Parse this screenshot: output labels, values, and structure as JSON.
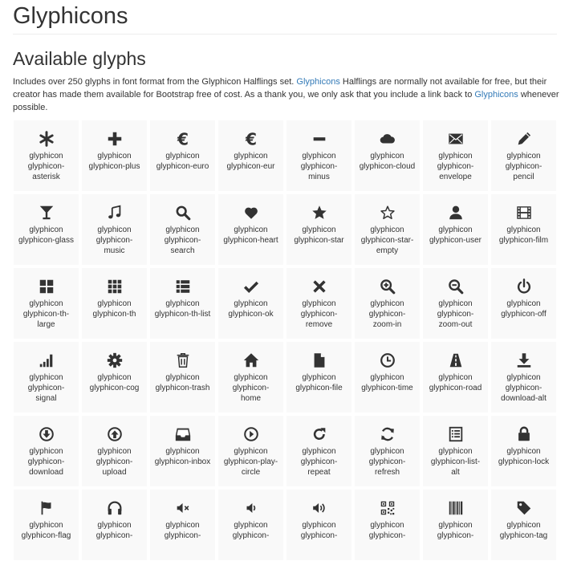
{
  "title": "Glyphicons",
  "subtitle": "Available glyphs",
  "intro": {
    "text1": "Includes over 250 glyphs in font format from the Glyphicon Halflings set.",
    "link1": "Glyphicons",
    "text2": "Halflings are normally not available for free, but their creator has made them available for Bootstrap free of cost. As a thank you, we only ask that you include a link back to",
    "link2": "Glyphicons",
    "text3": "whenever possible."
  },
  "colors": {
    "link": "#337ab7",
    "tile": "#f9f9f9",
    "text": "#333333"
  },
  "glyphs": [
    {
      "icon": "asterisk",
      "line1": "glyphicon",
      "line2": "glyphicon-",
      "line3": "asterisk"
    },
    {
      "icon": "plus",
      "line1": "glyphicon",
      "line2": "glyphicon-plus",
      "line3": ""
    },
    {
      "icon": "euro",
      "line1": "glyphicon",
      "line2": "glyphicon-euro",
      "line3": ""
    },
    {
      "icon": "eur",
      "line1": "glyphicon",
      "line2": "glyphicon-eur",
      "line3": ""
    },
    {
      "icon": "minus",
      "line1": "glyphicon",
      "line2": "glyphicon-",
      "line3": "minus"
    },
    {
      "icon": "cloud",
      "line1": "glyphicon",
      "line2": "glyphicon-cloud",
      "line3": ""
    },
    {
      "icon": "envelope",
      "line1": "glyphicon",
      "line2": "glyphicon-",
      "line3": "envelope"
    },
    {
      "icon": "pencil",
      "line1": "glyphicon",
      "line2": "glyphicon-",
      "line3": "pencil"
    },
    {
      "icon": "glass",
      "line1": "glyphicon",
      "line2": "glyphicon-glass",
      "line3": ""
    },
    {
      "icon": "music",
      "line1": "glyphicon",
      "line2": "glyphicon-",
      "line3": "music"
    },
    {
      "icon": "search",
      "line1": "glyphicon",
      "line2": "glyphicon-",
      "line3": "search"
    },
    {
      "icon": "heart",
      "line1": "glyphicon",
      "line2": "glyphicon-heart",
      "line3": ""
    },
    {
      "icon": "star",
      "line1": "glyphicon",
      "line2": "glyphicon-star",
      "line3": ""
    },
    {
      "icon": "star-empty",
      "line1": "glyphicon",
      "line2": "glyphicon-star-",
      "line3": "empty"
    },
    {
      "icon": "user",
      "line1": "glyphicon",
      "line2": "glyphicon-user",
      "line3": ""
    },
    {
      "icon": "film",
      "line1": "glyphicon",
      "line2": "glyphicon-film",
      "line3": ""
    },
    {
      "icon": "th-large",
      "line1": "glyphicon",
      "line2": "glyphicon-th-",
      "line3": "large"
    },
    {
      "icon": "th",
      "line1": "glyphicon",
      "line2": "glyphicon-th",
      "line3": ""
    },
    {
      "icon": "th-list",
      "line1": "glyphicon",
      "line2": "glyphicon-th-list",
      "line3": ""
    },
    {
      "icon": "ok",
      "line1": "glyphicon",
      "line2": "glyphicon-ok",
      "line3": ""
    },
    {
      "icon": "remove",
      "line1": "glyphicon",
      "line2": "glyphicon-",
      "line3": "remove"
    },
    {
      "icon": "zoom-in",
      "line1": "glyphicon",
      "line2": "glyphicon-",
      "line3": "zoom-in"
    },
    {
      "icon": "zoom-out",
      "line1": "glyphicon",
      "line2": "glyphicon-",
      "line3": "zoom-out"
    },
    {
      "icon": "off",
      "line1": "glyphicon",
      "line2": "glyphicon-off",
      "line3": ""
    },
    {
      "icon": "signal",
      "line1": "glyphicon",
      "line2": "glyphicon-",
      "line3": "signal"
    },
    {
      "icon": "cog",
      "line1": "glyphicon",
      "line2": "glyphicon-cog",
      "line3": ""
    },
    {
      "icon": "trash",
      "line1": "glyphicon",
      "line2": "glyphicon-trash",
      "line3": ""
    },
    {
      "icon": "home",
      "line1": "glyphicon",
      "line2": "glyphicon-",
      "line3": "home"
    },
    {
      "icon": "file",
      "line1": "glyphicon",
      "line2": "glyphicon-file",
      "line3": ""
    },
    {
      "icon": "time",
      "line1": "glyphicon",
      "line2": "glyphicon-time",
      "line3": ""
    },
    {
      "icon": "road",
      "line1": "glyphicon",
      "line2": "glyphicon-road",
      "line3": ""
    },
    {
      "icon": "download-alt",
      "line1": "glyphicon",
      "line2": "glyphicon-",
      "line3": "download-alt"
    },
    {
      "icon": "download",
      "line1": "glyphicon",
      "line2": "glyphicon-",
      "line3": "download"
    },
    {
      "icon": "upload",
      "line1": "glyphicon",
      "line2": "glyphicon-",
      "line3": "upload"
    },
    {
      "icon": "inbox",
      "line1": "glyphicon",
      "line2": "glyphicon-inbox",
      "line3": ""
    },
    {
      "icon": "play-circle",
      "line1": "glyphicon",
      "line2": "glyphicon-play-",
      "line3": "circle"
    },
    {
      "icon": "repeat",
      "line1": "glyphicon",
      "line2": "glyphicon-",
      "line3": "repeat"
    },
    {
      "icon": "refresh",
      "line1": "glyphicon",
      "line2": "glyphicon-",
      "line3": "refresh"
    },
    {
      "icon": "list-alt",
      "line1": "glyphicon",
      "line2": "glyphicon-list-",
      "line3": "alt"
    },
    {
      "icon": "lock",
      "line1": "glyphicon",
      "line2": "glyphicon-lock",
      "line3": ""
    },
    {
      "icon": "flag",
      "line1": "glyphicon",
      "line2": "glyphicon-flag",
      "line3": ""
    },
    {
      "icon": "headphones",
      "line1": "glyphicon",
      "line2": "glyphicon-",
      "line3": ""
    },
    {
      "icon": "volume-off",
      "line1": "glyphicon",
      "line2": "glyphicon-",
      "line3": ""
    },
    {
      "icon": "volume-down",
      "line1": "glyphicon",
      "line2": "glyphicon-",
      "line3": ""
    },
    {
      "icon": "volume-up",
      "line1": "glyphicon",
      "line2": "glyphicon-",
      "line3": ""
    },
    {
      "icon": "qrcode",
      "line1": "glyphicon",
      "line2": "glyphicon-",
      "line3": ""
    },
    {
      "icon": "barcode",
      "line1": "glyphicon",
      "line2": "glyphicon-",
      "line3": ""
    },
    {
      "icon": "tag",
      "line1": "glyphicon",
      "line2": "glyphicon-tag",
      "line3": ""
    }
  ]
}
